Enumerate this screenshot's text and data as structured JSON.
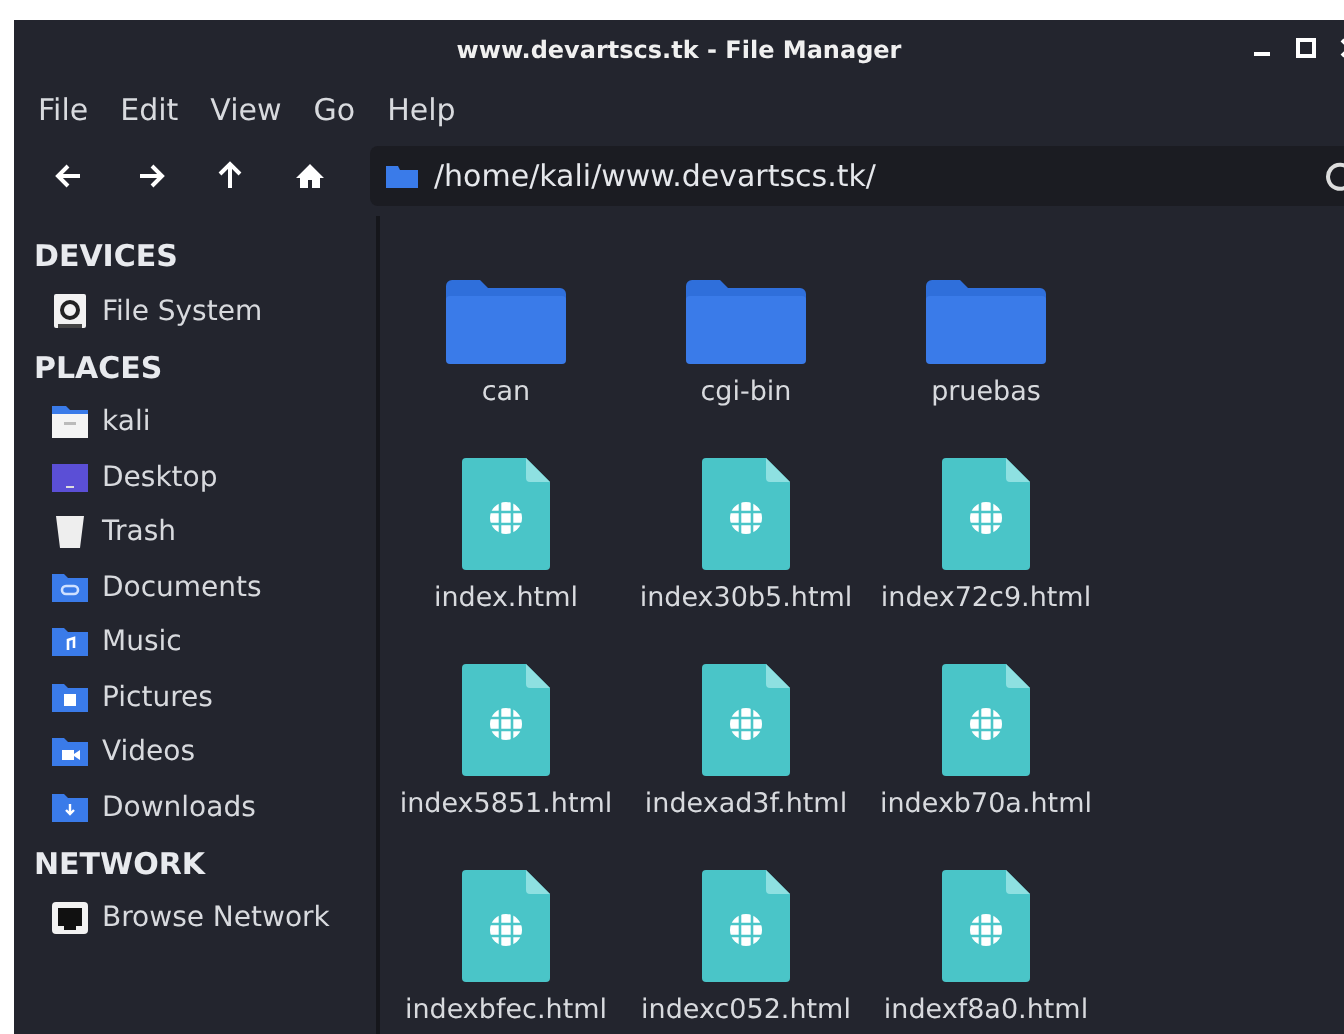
{
  "window": {
    "title": "www.devartscs.tk - File Manager"
  },
  "menu": [
    "File",
    "Edit",
    "View",
    "Go",
    "Help"
  ],
  "location": {
    "value": "/home/kali/www.devartscs.tk/"
  },
  "sidebar": [
    {
      "heading": "DEVICES",
      "items": [
        {
          "label": "File System",
          "kind": "drive"
        }
      ]
    },
    {
      "heading": "PLACES",
      "items": [
        {
          "label": "kali",
          "kind": "home"
        },
        {
          "label": "Desktop",
          "kind": "desktop"
        },
        {
          "label": "Trash",
          "kind": "trash"
        },
        {
          "label": "Documents",
          "kind": "documents"
        },
        {
          "label": "Music",
          "kind": "music"
        },
        {
          "label": "Pictures",
          "kind": "pictures"
        },
        {
          "label": "Videos",
          "kind": "videos"
        },
        {
          "label": "Downloads",
          "kind": "downloads"
        }
      ]
    },
    {
      "heading": "NETWORK",
      "items": [
        {
          "label": "Browse Network",
          "kind": "network"
        }
      ]
    }
  ],
  "files": [
    {
      "name": "can",
      "kind": "folder"
    },
    {
      "name": "cgi-bin",
      "kind": "folder"
    },
    {
      "name": "pruebas",
      "kind": "folder"
    },
    {
      "name": "index.html",
      "kind": "html"
    },
    {
      "name": "index30b5.html",
      "kind": "html"
    },
    {
      "name": "index72c9.html",
      "kind": "html"
    },
    {
      "name": "index5851.html",
      "kind": "html"
    },
    {
      "name": "indexad3f.html",
      "kind": "html"
    },
    {
      "name": "indexb70a.html",
      "kind": "html"
    },
    {
      "name": "indexbfec.html",
      "kind": "html"
    },
    {
      "name": "indexc052.html",
      "kind": "html"
    },
    {
      "name": "indexf8a0.html",
      "kind": "html"
    }
  ]
}
